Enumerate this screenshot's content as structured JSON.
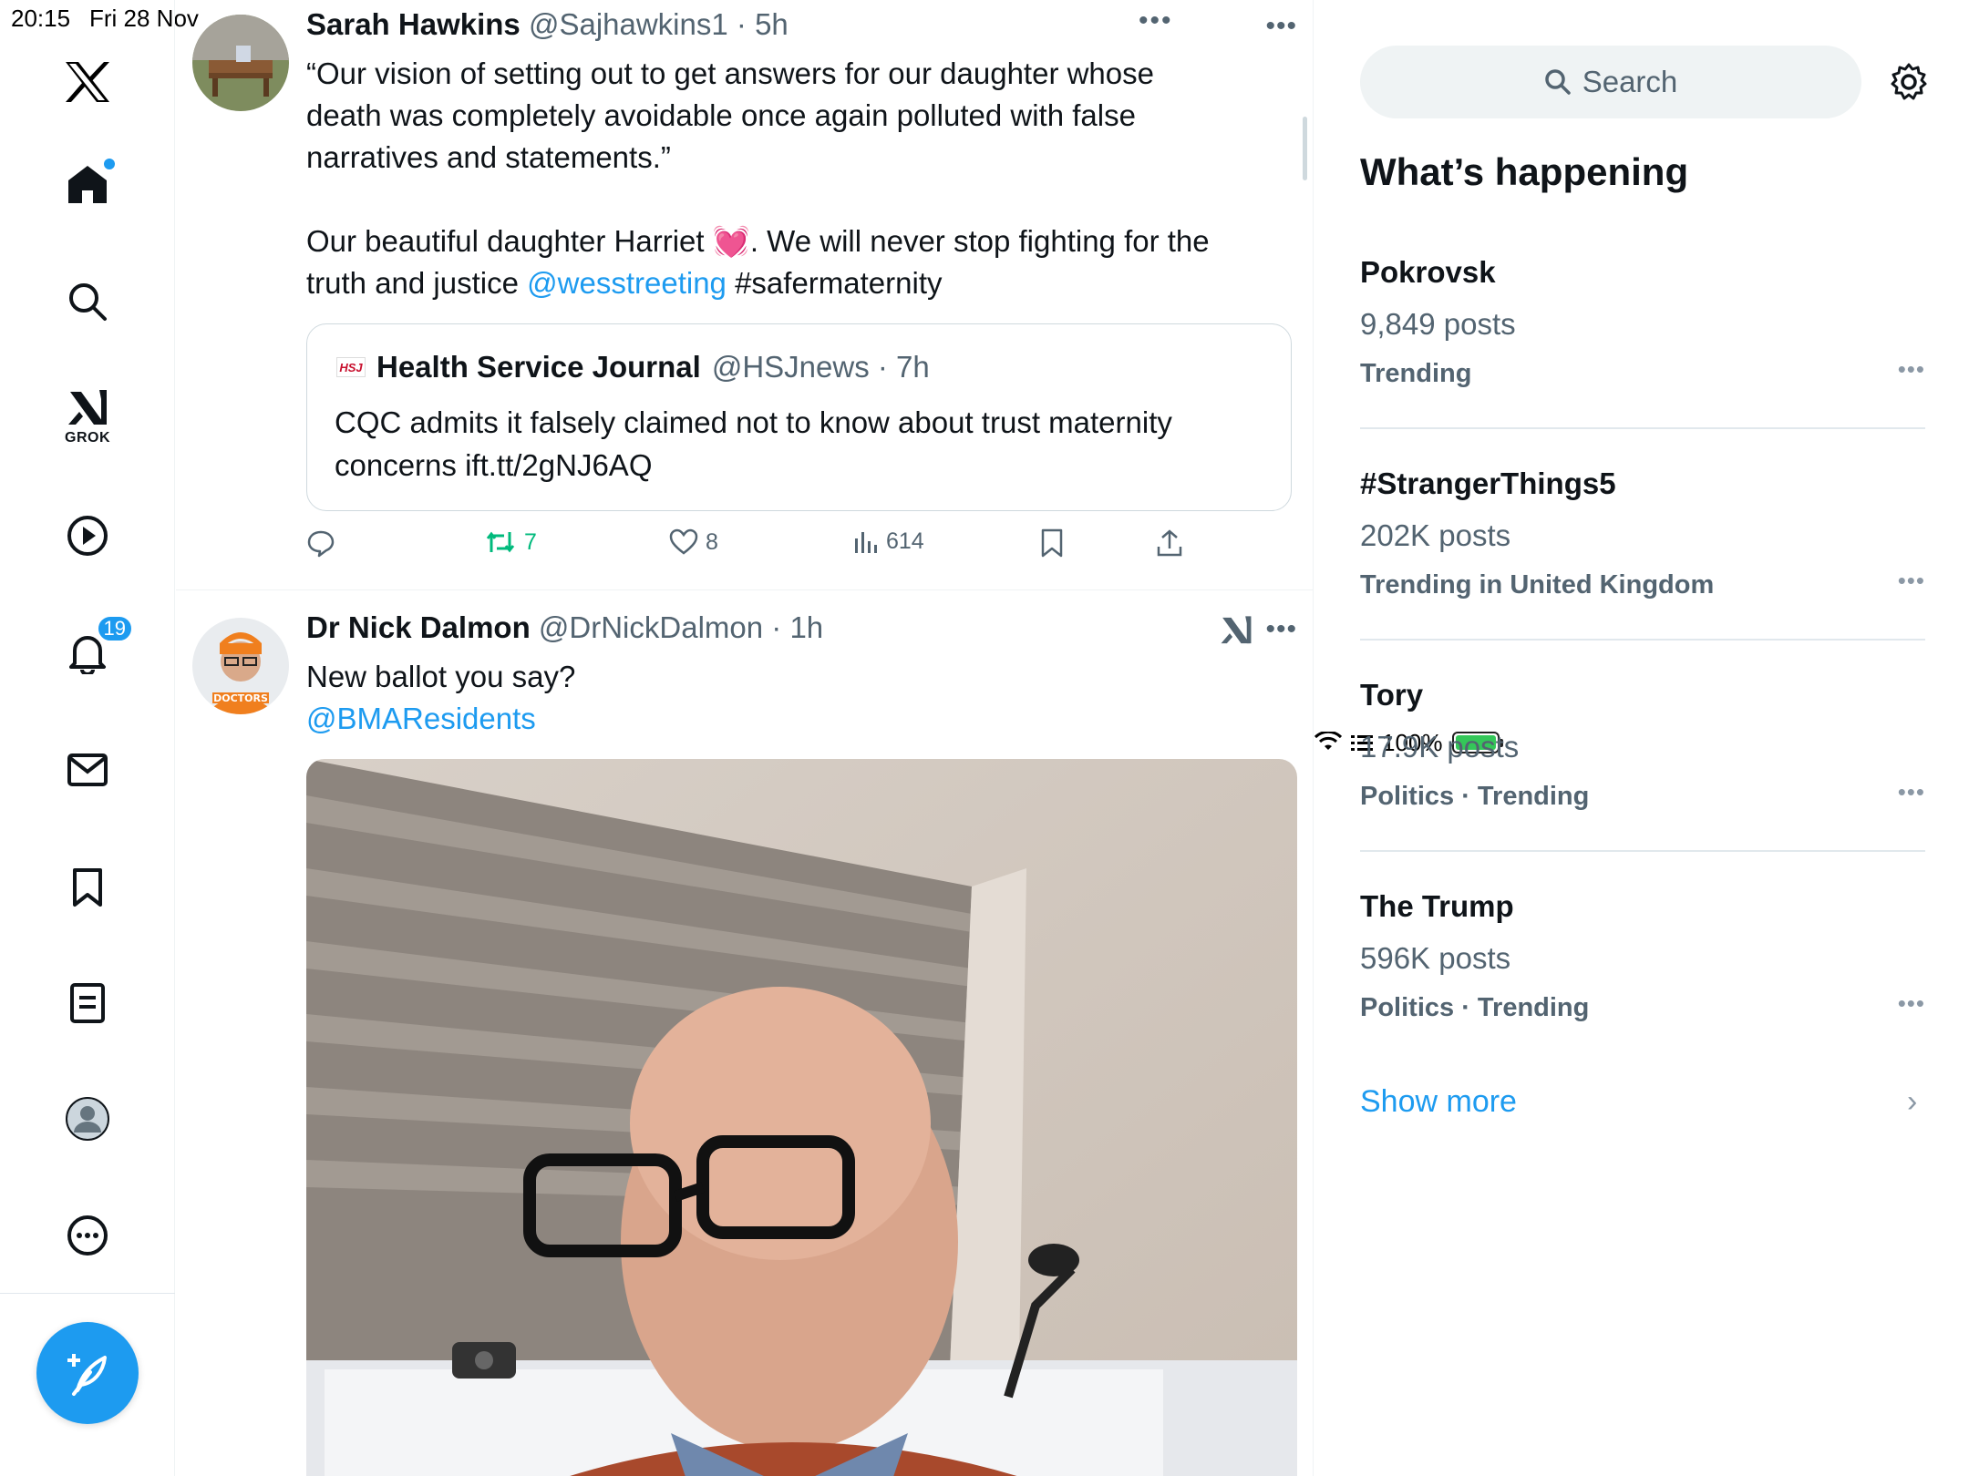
{
  "status_bar": {
    "time": "20:15",
    "date": "Fri 28 Nov",
    "battery": "100%"
  },
  "nav": {
    "grok_label": "GROK",
    "notifications_badge": "19"
  },
  "timeline": {
    "tweets": [
      {
        "name": "Sarah Hawkins",
        "handle": "@Sajhawkins1",
        "time": "5h",
        "text_line1": "“Our vision of setting out to get answers for our daughter whose death was completely avoidable once again polluted with false narratives and statements.”",
        "text_line2_pre": "Our beautiful daughter Harriet 💓. We will never stop fighting for the truth and justice ",
        "text_mention": "@wesstreeting",
        "text_hashtag": " #safermaternity",
        "quote": {
          "logo": "HSJ",
          "name": "Health Service Journal",
          "handle": "@HSJnews",
          "time": "7h",
          "text": "CQC admits it falsely claimed not to know about trust maternity concerns ift.tt/2gNJ6AQ"
        },
        "reposts": "7",
        "likes": "8",
        "views": "614"
      },
      {
        "name": "Dr Nick Dalmon",
        "handle": "@DrNickDalmon",
        "time": "1h",
        "text": "New ballot you say?",
        "mention": "@BMAResidents"
      }
    ]
  },
  "sidebar": {
    "search_placeholder": "Search",
    "section_title": "What’s happening",
    "trends": [
      {
        "name": "Pokrovsk",
        "posts": "9,849 posts",
        "category": "Trending"
      },
      {
        "name": "#StrangerThings5",
        "posts": "202K posts",
        "category": "Trending in United Kingdom"
      },
      {
        "name": "Tory",
        "posts": "17.9K posts",
        "category": "Politics · Trending"
      },
      {
        "name": "The Trump",
        "posts": "596K posts",
        "category": "Politics · Trending"
      }
    ],
    "show_more": "Show more"
  }
}
